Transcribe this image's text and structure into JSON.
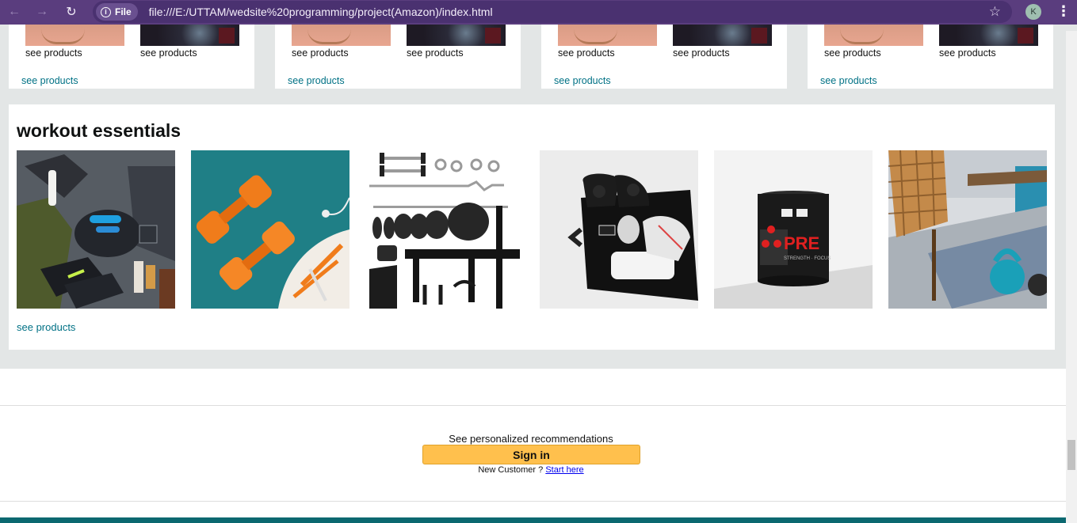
{
  "browser": {
    "file_chip_label": "File",
    "url": "file:///E:/UTTAM/wedsite%20programming/project(Amazon)/index.html",
    "profile_initial": "K",
    "icons": [
      "back-arrow-icon",
      "forward-arrow-icon",
      "reload-icon",
      "info-icon",
      "star-icon",
      "kebab-menu-icon"
    ]
  },
  "top_cards": [
    {
      "left_label": "see products",
      "right_label": "see products",
      "link": "see products"
    },
    {
      "left_label": "see products",
      "right_label": "see products",
      "link": "see products"
    },
    {
      "left_label": "see products",
      "right_label": "see products",
      "link": "see products"
    },
    {
      "left_label": "see products",
      "right_label": "see products",
      "link": "see products"
    }
  ],
  "workout": {
    "title": "workout essentials",
    "images": [
      "gym-bag-flatlay-image",
      "orange-dumbbells-image",
      "home-gym-set-image",
      "black-duffel-bag-image",
      "preworkout-tub-image",
      "kettlebell-room-image"
    ],
    "link": "see products"
  },
  "signin": {
    "recommend_text": "See personalized recommendations",
    "button_label": "Sign in",
    "new_customer_text": "New Customer ? ",
    "start_here_link": "Start here"
  },
  "colors": {
    "chrome": "#5a3d7e",
    "link": "#007185",
    "signin_button": "#ffc04d",
    "footer": "#0b6870",
    "page_bg": "#e3e6e6"
  }
}
